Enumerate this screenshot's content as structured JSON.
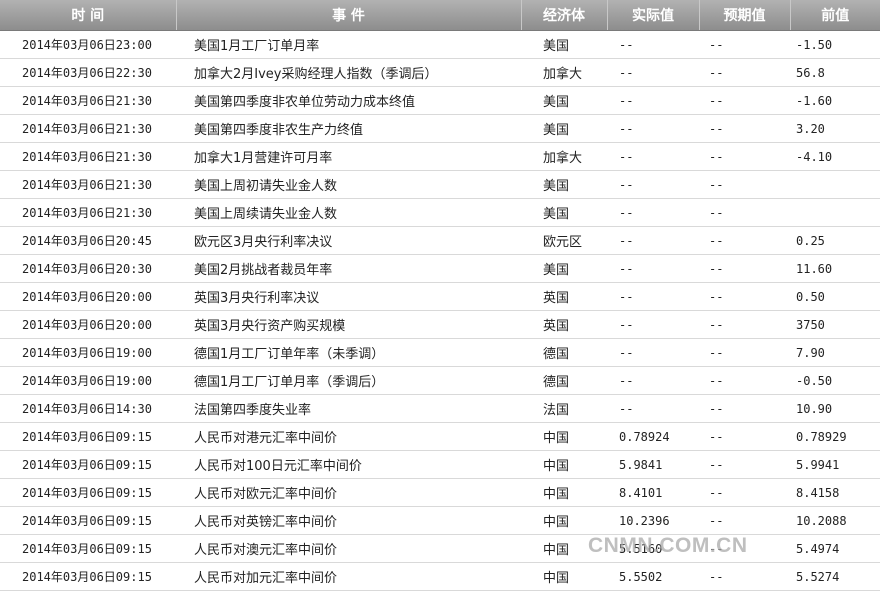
{
  "table": {
    "headers": {
      "time": "时 间",
      "event": "事 件",
      "economy": "经济体",
      "actual": "实际值",
      "forecast": "预期值",
      "previous": "前值"
    },
    "rows": [
      {
        "time": "2014年03月06日23:00",
        "event": "美国1月工厂订单月率",
        "economy": "美国",
        "actual": "--",
        "forecast": "--",
        "previous": "-1.50"
      },
      {
        "time": "2014年03月06日22:30",
        "event": "加拿大2月Ivey采购经理人指数（季调后）",
        "economy": "加拿大",
        "actual": "--",
        "forecast": "--",
        "previous": "56.8"
      },
      {
        "time": "2014年03月06日21:30",
        "event": "美国第四季度非农单位劳动力成本终值",
        "economy": "美国",
        "actual": "--",
        "forecast": "--",
        "previous": "-1.60"
      },
      {
        "time": "2014年03月06日21:30",
        "event": "美国第四季度非农生产力终值",
        "economy": "美国",
        "actual": "--",
        "forecast": "--",
        "previous": "3.20"
      },
      {
        "time": "2014年03月06日21:30",
        "event": "加拿大1月营建许可月率",
        "economy": "加拿大",
        "actual": "--",
        "forecast": "--",
        "previous": "-4.10"
      },
      {
        "time": "2014年03月06日21:30",
        "event": "美国上周初请失业金人数",
        "economy": "美国",
        "actual": "--",
        "forecast": "--",
        "previous": ""
      },
      {
        "time": "2014年03月06日21:30",
        "event": "美国上周续请失业金人数",
        "economy": "美国",
        "actual": "--",
        "forecast": "--",
        "previous": ""
      },
      {
        "time": "2014年03月06日20:45",
        "event": "欧元区3月央行利率决议",
        "economy": "欧元区",
        "actual": "--",
        "forecast": "--",
        "previous": "0.25"
      },
      {
        "time": "2014年03月06日20:30",
        "event": "美国2月挑战者裁员年率",
        "economy": "美国",
        "actual": "--",
        "forecast": "--",
        "previous": "11.60"
      },
      {
        "time": "2014年03月06日20:00",
        "event": "英国3月央行利率决议",
        "economy": "英国",
        "actual": "--",
        "forecast": "--",
        "previous": "0.50"
      },
      {
        "time": "2014年03月06日20:00",
        "event": "英国3月央行资产购买规模",
        "economy": "英国",
        "actual": "--",
        "forecast": "--",
        "previous": "3750"
      },
      {
        "time": "2014年03月06日19:00",
        "event": "德国1月工厂订单年率（未季调）",
        "economy": "德国",
        "actual": "--",
        "forecast": "--",
        "previous": "7.90"
      },
      {
        "time": "2014年03月06日19:00",
        "event": "德国1月工厂订单月率（季调后）",
        "economy": "德国",
        "actual": "--",
        "forecast": "--",
        "previous": "-0.50"
      },
      {
        "time": "2014年03月06日14:30",
        "event": "法国第四季度失业率",
        "economy": "法国",
        "actual": "--",
        "forecast": "--",
        "previous": "10.90"
      },
      {
        "time": "2014年03月06日09:15",
        "event": "人民币对港元汇率中间价",
        "economy": "中国",
        "actual": "0.78924",
        "forecast": "--",
        "previous": "0.78929"
      },
      {
        "time": "2014年03月06日09:15",
        "event": "人民币对100日元汇率中间价",
        "economy": "中国",
        "actual": "5.9841",
        "forecast": "--",
        "previous": "5.9941"
      },
      {
        "time": "2014年03月06日09:15",
        "event": "人民币对欧元汇率中间价",
        "economy": "中国",
        "actual": "8.4101",
        "forecast": "--",
        "previous": "8.4158"
      },
      {
        "time": "2014年03月06日09:15",
        "event": "人民币对英镑汇率中间价",
        "economy": "中国",
        "actual": "10.2396",
        "forecast": "--",
        "previous": "10.2088"
      },
      {
        "time": "2014年03月06日09:15",
        "event": "人民币对澳元汇率中间价",
        "economy": "中国",
        "actual": "5.5160",
        "forecast": "--",
        "previous": "5.4974"
      },
      {
        "time": "2014年03月06日09:15",
        "event": "人民币对加元汇率中间价",
        "economy": "中国",
        "actual": "5.5502",
        "forecast": "--",
        "previous": "5.5274"
      }
    ]
  },
  "watermark": "CNMN.COM.CN"
}
